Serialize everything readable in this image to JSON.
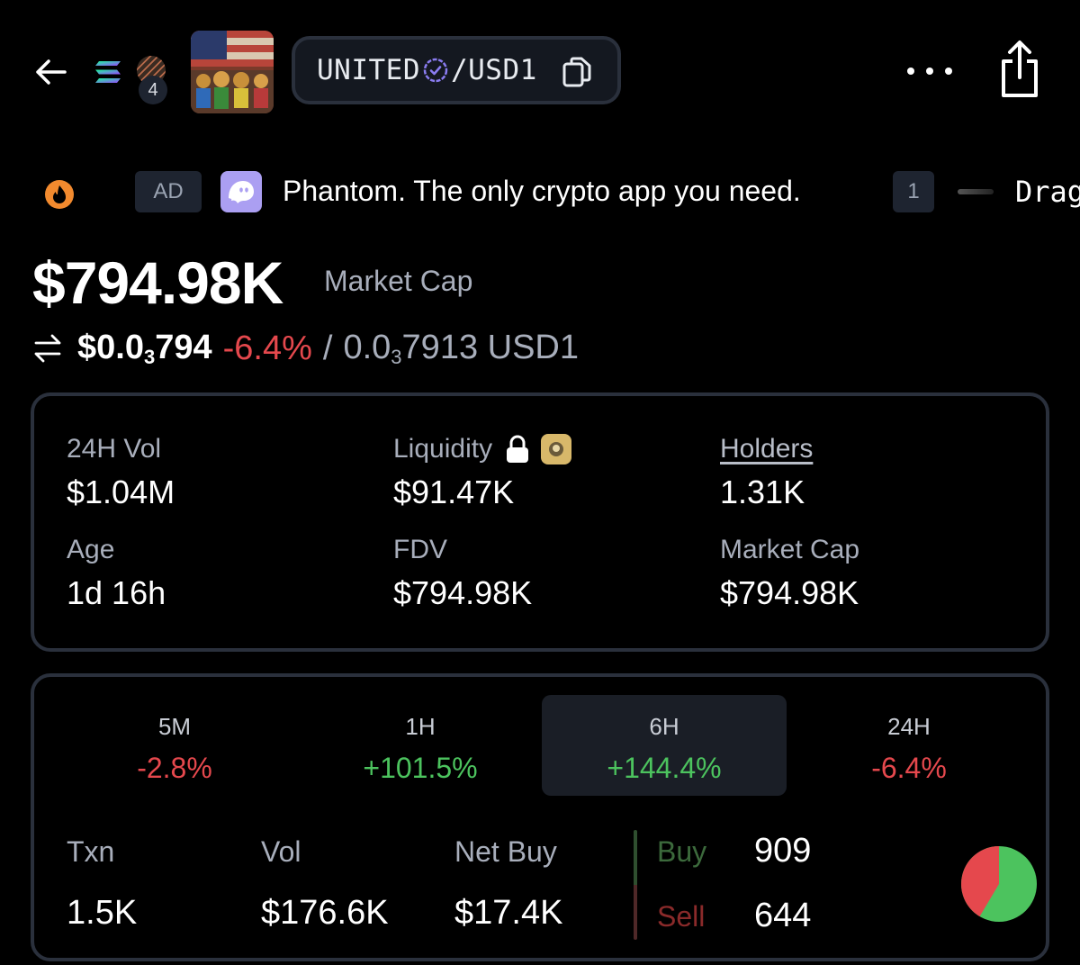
{
  "header": {
    "dex_count": "4",
    "pair_base": "UNITED",
    "pair_sep_quote": "/USD1"
  },
  "ticker": {
    "ad_badge": "AD",
    "ad_text": "Phantom. The only crypto app you need.",
    "rank": "1",
    "next_text": "Drag"
  },
  "price": {
    "market_cap": "$794.98K",
    "market_cap_label": "Market Cap",
    "usd_prefix": "$0.0",
    "usd_zeros": "3",
    "usd_digits": "794",
    "change": "-6.4%",
    "separator": "/",
    "native_prefix": "0.0",
    "native_zeros": "3",
    "native_digits": "7913 USD1"
  },
  "stats": [
    {
      "label": "24H Vol",
      "value": "$1.04M"
    },
    {
      "label": "Liquidity",
      "value": "$91.47K"
    },
    {
      "label": "Holders",
      "value": "1.31K"
    },
    {
      "label": "Age",
      "value": "1d 16h"
    },
    {
      "label": "FDV",
      "value": "$794.98K"
    },
    {
      "label": "Market Cap",
      "value": "$794.98K"
    }
  ],
  "timeframes": [
    {
      "name": "5M",
      "change": "-2.8%",
      "direction": "down"
    },
    {
      "name": "1H",
      "change": "+101.5%",
      "direction": "up"
    },
    {
      "name": "6H",
      "change": "+144.4%",
      "direction": "up",
      "active": true
    },
    {
      "name": "24H",
      "change": "-6.4%",
      "direction": "down"
    }
  ],
  "txns": {
    "txn_label": "Txn",
    "txn_value": "1.5K",
    "vol_label": "Vol",
    "vol_value": "$176.6K",
    "netbuy_label": "Net Buy",
    "netbuy_value": "$17.4K",
    "buy_label": "Buy",
    "buy_value": "909",
    "sell_label": "Sell",
    "sell_value": "644"
  },
  "colors": {
    "positive": "#4cc35e",
    "negative": "#e5484d",
    "card_border": "#2a303c"
  },
  "icons": [
    "back-arrow-icon",
    "solana-icon",
    "dex-icon",
    "verified-icon",
    "copy-icon",
    "more-icon",
    "share-icon",
    "fire-icon",
    "phantom-icon",
    "swap-icon",
    "lock-icon",
    "locker-icon",
    "buy-sell-pie-icon"
  ]
}
